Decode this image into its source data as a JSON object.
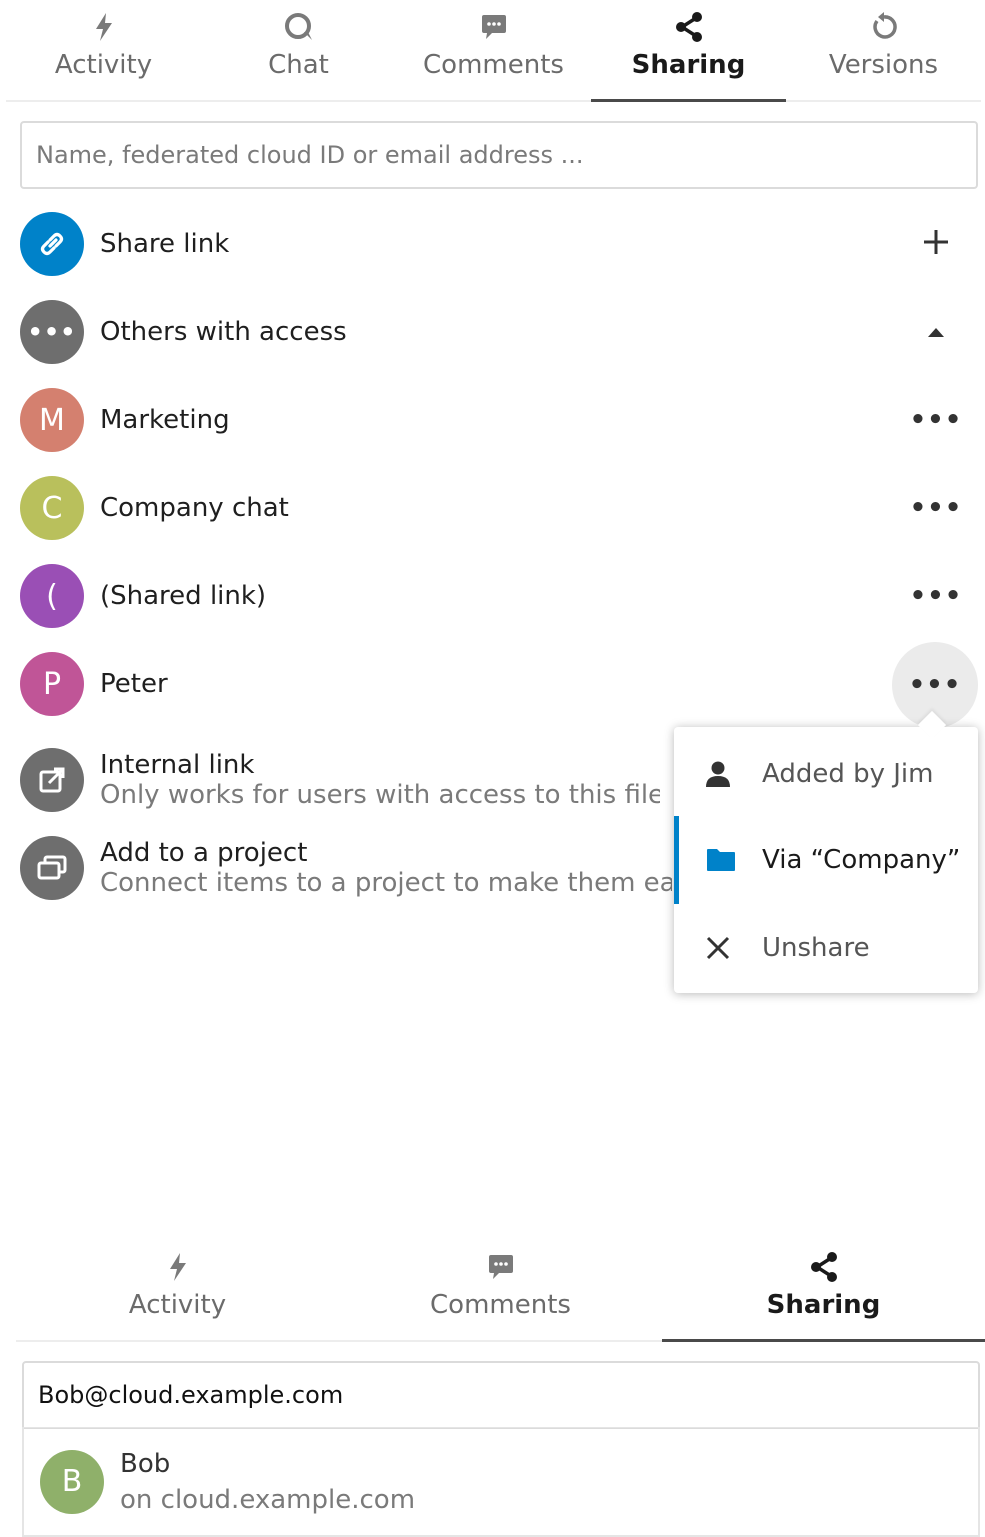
{
  "panel1": {
    "tabs": [
      {
        "label": "Activity",
        "icon": "activity-icon"
      },
      {
        "label": "Chat",
        "icon": "chat-icon"
      },
      {
        "label": "Comments",
        "icon": "comments-icon"
      },
      {
        "label": "Sharing",
        "icon": "share-icon",
        "active": true
      },
      {
        "label": "Versions",
        "icon": "history-icon"
      }
    ],
    "search_placeholder": "Name, federated cloud ID or email address ...",
    "share_link": {
      "label": "Share link",
      "action": "+"
    },
    "others": {
      "label": "Others with access"
    },
    "shares": [
      {
        "initial": "M",
        "name": "Marketing",
        "color": "#d4806f"
      },
      {
        "initial": "C",
        "name": "Company chat",
        "color": "#b9c05c"
      },
      {
        "initial": "(",
        "name": "(Shared link)",
        "color": "#9a4fb5"
      },
      {
        "initial": "P",
        "name": "Peter",
        "color": "#c05597"
      }
    ],
    "internal_link": {
      "title": "Internal link",
      "subtitle": "Only works for users with access to this file"
    },
    "project": {
      "title": "Add to a project",
      "subtitle": "Connect items to a project to make them easier to find"
    },
    "menu": {
      "added_by": "Added by Jim",
      "via": "Via “Company”",
      "unshare": "Unshare"
    },
    "colors": {
      "blue": "#0082c9",
      "gray_avatar": "#6e6e6e"
    }
  },
  "panel2": {
    "tabs": [
      {
        "label": "Activity",
        "icon": "activity-icon"
      },
      {
        "label": "Comments",
        "icon": "comments-icon"
      },
      {
        "label": "Sharing",
        "icon": "share-icon",
        "active": true
      }
    ],
    "search_value": "Bob@cloud.example.com",
    "result": {
      "initial": "B",
      "name": "Bob",
      "subtitle": "on cloud.example.com",
      "color": "#8fb06a"
    }
  }
}
